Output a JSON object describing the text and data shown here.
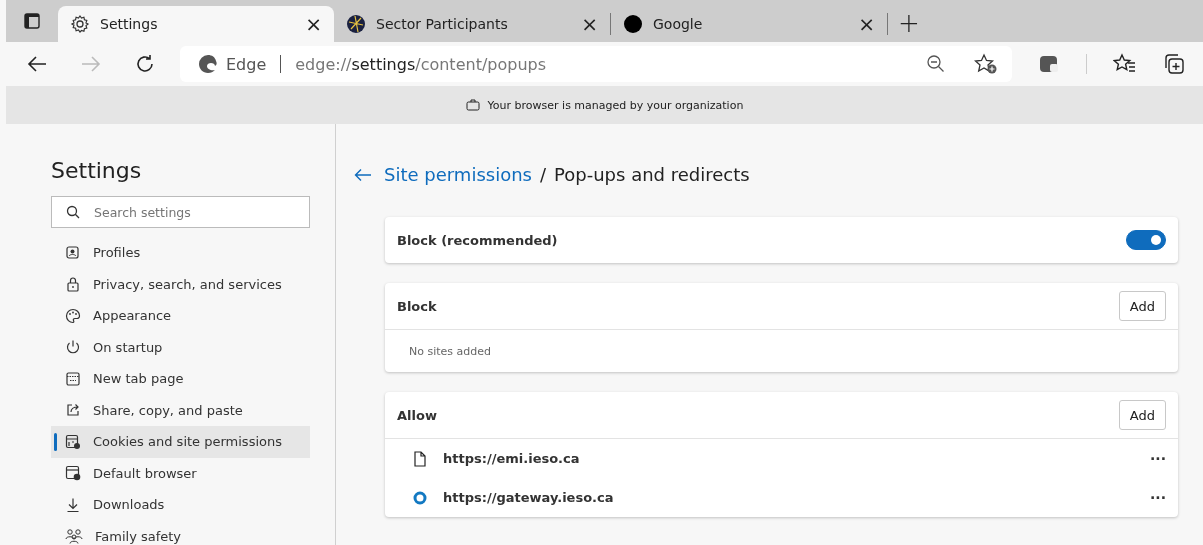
{
  "tabs": [
    {
      "title": "Settings",
      "kind": "gear",
      "selected": true,
      "close": "×"
    },
    {
      "title": "Sector Participants",
      "kind": "globe",
      "selected": false,
      "close": "×"
    },
    {
      "title": "Google",
      "kind": "dot",
      "selected": false,
      "close": "×"
    }
  ],
  "new_tab": "+",
  "address_bar": {
    "site_label": "Edge",
    "scheme": "edge://",
    "host": "settings",
    "path": "/content/popups"
  },
  "managed_notice": "Your browser is managed by your organization",
  "sidebar": {
    "title": "Settings",
    "search": {
      "placeholder": "Search settings"
    },
    "items": [
      {
        "label": "Profiles",
        "kind": "profile",
        "selected": false
      },
      {
        "label": "Privacy, search, and services",
        "kind": "lock",
        "selected": false
      },
      {
        "label": "Appearance",
        "kind": "palette",
        "selected": false
      },
      {
        "label": "On startup",
        "kind": "power",
        "selected": false
      },
      {
        "label": "New tab page",
        "kind": "newtab",
        "selected": false
      },
      {
        "label": "Share, copy, and paste",
        "kind": "share",
        "selected": false
      },
      {
        "label": "Cookies and site permissions",
        "kind": "cookies",
        "selected": true
      },
      {
        "label": "Default browser",
        "kind": "browser",
        "selected": false
      },
      {
        "label": "Downloads",
        "kind": "download",
        "selected": false
      },
      {
        "label": "Family safety",
        "kind": "family",
        "selected": false
      }
    ]
  },
  "breadcrumb": {
    "parent": "Site permissions",
    "separator": "/",
    "current": "Pop-ups and redirects"
  },
  "block_toggle": {
    "label": "Block (recommended)",
    "on": true
  },
  "block_section": {
    "title": "Block",
    "button": "Add",
    "empty_text": "No sites added"
  },
  "allow_section": {
    "title": "Allow",
    "button": "Add",
    "sites": [
      {
        "url": "https://emi.ieso.ca",
        "kind": "file",
        "more": "···"
      },
      {
        "url": "https://gateway.ieso.ca",
        "kind": "ring",
        "more": "···"
      }
    ]
  }
}
